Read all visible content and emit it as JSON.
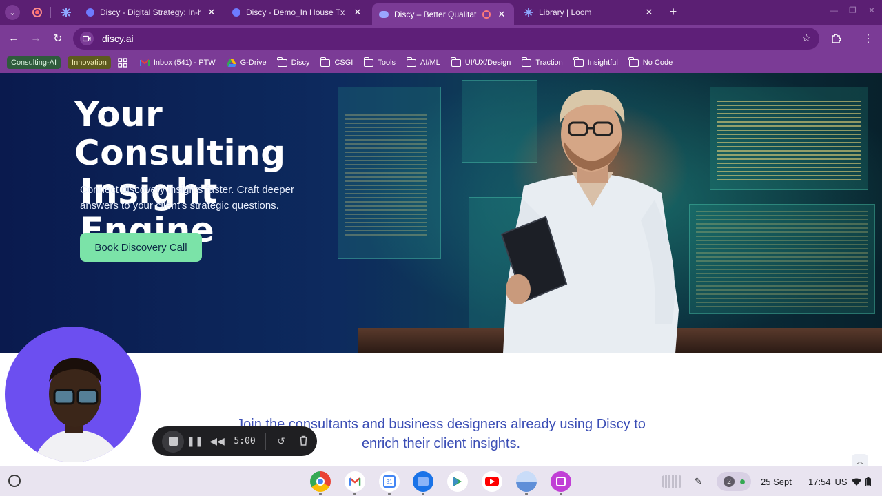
{
  "browser": {
    "tabs": [
      {
        "title": "Discy - Digital Strategy: In-house",
        "active": false
      },
      {
        "title": "Discy - Demo_In House Tx",
        "active": false
      },
      {
        "title": "Discy – Better Qualitative D",
        "active": true
      },
      {
        "title": "Library | Loom",
        "active": false
      }
    ],
    "close_glyph": "✕",
    "new_tab_glyph": "+",
    "url": "discy.ai",
    "bookmarks": {
      "chips": [
        {
          "label": "Consulting-AI",
          "bg": "#2f5b3c",
          "fg": "#d9f2de"
        },
        {
          "label": "Innovation",
          "bg": "#5d5a1e",
          "fg": "#f3efb2"
        }
      ],
      "items": [
        {
          "label": "Inbox (541) - PTW",
          "icon": "gmail-icon"
        },
        {
          "label": "G-Drive",
          "icon": "drive-icon"
        },
        {
          "label": "Discy",
          "icon": "folder-icon"
        },
        {
          "label": "CSGI",
          "icon": "folder-icon"
        },
        {
          "label": "Tools",
          "icon": "folder-icon"
        },
        {
          "label": "AI/ML",
          "icon": "folder-icon"
        },
        {
          "label": "UI/UX/Design",
          "icon": "folder-icon"
        },
        {
          "label": "Traction",
          "icon": "folder-icon"
        },
        {
          "label": "Insightful",
          "icon": "folder-icon"
        },
        {
          "label": "No Code",
          "icon": "folder-icon"
        }
      ]
    }
  },
  "hero": {
    "title_line1": "Your Consulting",
    "title_line2": "Insight Engine",
    "subtitle": "Connect discovery insights faster. Craft deeper answers to your client's strategic questions.",
    "cta": "Book Discovery Call"
  },
  "body": {
    "join_line1": "Join the consultants and business designers already using Discy to",
    "join_line2": "enrich their client insights."
  },
  "recorder": {
    "time": "5:00"
  },
  "shelf": {
    "apps": [
      "chrome-icon",
      "gmail-icon",
      "calendar-icon",
      "files-icon",
      "play-store-icon",
      "youtube-icon",
      "app-icon",
      "screencast-icon"
    ],
    "notification_count": "2",
    "date": "25 Sept",
    "time": "17:54",
    "locale": "US"
  },
  "colors": {
    "browser_frame": "#5b1f73",
    "toolbar": "#7b3b96",
    "cta": "#7be3a8",
    "join_text": "#3a4db5",
    "webcam_bg": "#6c4ff0"
  }
}
